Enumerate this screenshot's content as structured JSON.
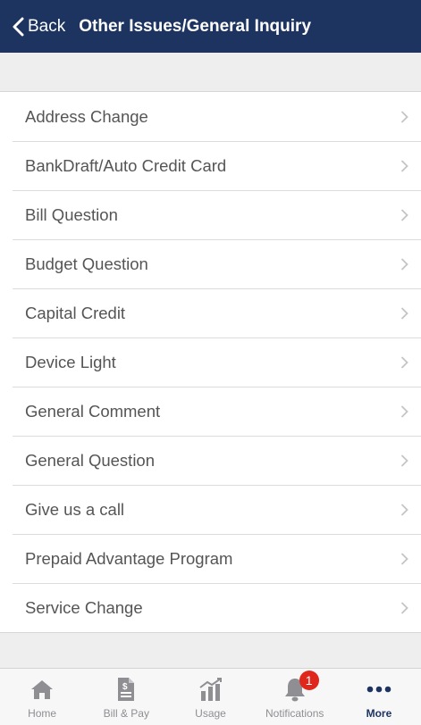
{
  "header": {
    "back_label": "Back",
    "title": "Other Issues/General Inquiry"
  },
  "list": {
    "items": [
      {
        "label": "Address Change"
      },
      {
        "label": "BankDraft/Auto Credit Card"
      },
      {
        "label": "Bill Question"
      },
      {
        "label": "Budget Question"
      },
      {
        "label": "Capital Credit"
      },
      {
        "label": "Device Light"
      },
      {
        "label": "General Comment"
      },
      {
        "label": "General Question"
      },
      {
        "label": "Give us a call"
      },
      {
        "label": "Prepaid Advantage Program"
      },
      {
        "label": "Service Change"
      }
    ]
  },
  "tabbar": {
    "tabs": [
      {
        "label": "Home",
        "icon": "home-icon"
      },
      {
        "label": "Bill & Pay",
        "icon": "bill-icon"
      },
      {
        "label": "Usage",
        "icon": "usage-chart-icon"
      },
      {
        "label": "Notifications",
        "icon": "bell-icon",
        "badge": "1"
      },
      {
        "label": "More",
        "icon": "more-dots-icon",
        "active": true
      }
    ]
  },
  "colors": {
    "header_bg": "#1d3461",
    "active_tab": "#1d3461",
    "inactive_tab": "#8e8e93",
    "badge": "#e0271c"
  }
}
